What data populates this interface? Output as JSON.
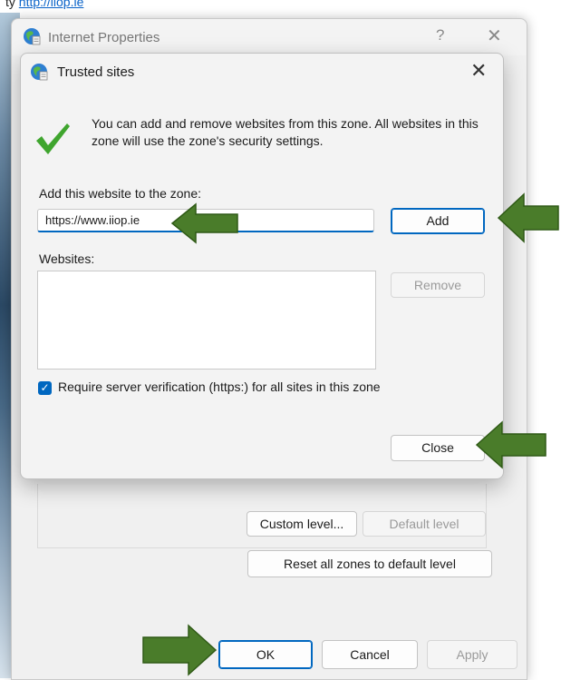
{
  "top_link": {
    "prefix": "ty",
    "link_text": "http://iiop.ie"
  },
  "outer_window": {
    "title": "Internet Properties",
    "help": "?",
    "close": "✕",
    "buttons": {
      "custom_level": "Custom level...",
      "default_level": "Default level",
      "reset_all": "Reset all zones to default level",
      "ok": "OK",
      "cancel": "Cancel",
      "apply": "Apply"
    }
  },
  "dialog": {
    "title": "Trusted sites",
    "close": "✕",
    "info_text": "You can add and remove websites from this zone. All websites in this zone will use the zone's security settings.",
    "add_label": "Add this website to the zone:",
    "url_value": "https://www.iiop.ie",
    "add_button": "Add",
    "websites_label": "Websites:",
    "remove_button": "Remove",
    "require_verification": "Require server verification (https:) for all sites in this zone",
    "require_verification_checked": true,
    "close_button": "Close"
  },
  "colors": {
    "accent": "#0067c0",
    "arrow": "#4a7c2a",
    "check_green": "#3fa52e"
  }
}
